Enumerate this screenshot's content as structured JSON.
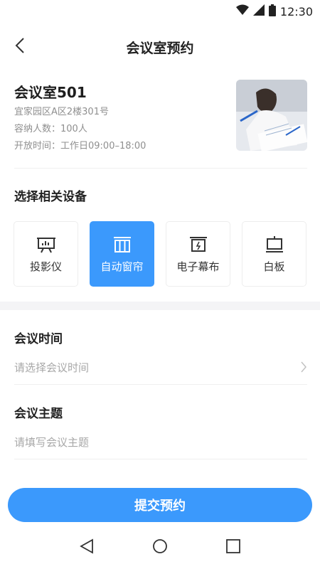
{
  "status": {
    "time": "12:30"
  },
  "nav": {
    "title": "会议室预约"
  },
  "room": {
    "name": "会议室501",
    "address": "宜家园区A区2楼301号",
    "capacity": "容纳人数：100人",
    "hours": "开放时间：工作日09:00–18:00"
  },
  "devices": {
    "title": "选择相关设备",
    "items": [
      {
        "label": "投影仪",
        "icon": "projector-icon",
        "selected": false
      },
      {
        "label": "自动窗帘",
        "icon": "curtain-icon",
        "selected": true
      },
      {
        "label": "电子幕布",
        "icon": "screen-icon",
        "selected": false
      },
      {
        "label": "白板",
        "icon": "whiteboard-icon",
        "selected": false
      }
    ]
  },
  "form": {
    "time_label": "会议时间",
    "time_placeholder": "请选择会议时间",
    "topic_label": "会议主题",
    "topic_placeholder": "请填写会议主题"
  },
  "submit_label": "提交预约",
  "colors": {
    "accent": "#3b99fc",
    "muted": "#a8a8a8"
  }
}
